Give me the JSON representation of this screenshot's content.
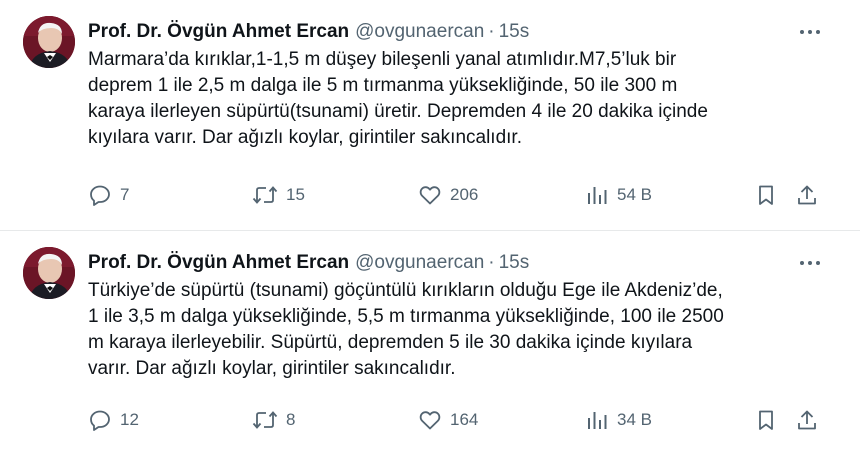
{
  "tweets": [
    {
      "author": {
        "name": "Prof. Dr. Övgün Ahmet Ercan",
        "handle": "@ovgunaercan",
        "separator": "·",
        "time": "15s"
      },
      "lines": [
        "Marmara’da kırıklar,1-1,5 m düşey bileşenli yanal atımlıdır.M7,5’luk bir",
        "deprem 1 ile 2,5 m dalga ile 5 m tırmanma yüksekliğinde, 50 ile 300 m",
        "karaya ilerleyen süpürtü(tsunami) üretir. Depremden 4 ile 20 dakika içinde",
        "kıyılara varır. Dar ağızlı koylar, girintiler sakıncalıdır."
      ],
      "stats": {
        "replies": "7",
        "reposts": "15",
        "likes": "206",
        "views": "54 B"
      }
    },
    {
      "author": {
        "name": "Prof. Dr. Övgün Ahmet Ercan",
        "handle": "@ovgunaercan",
        "separator": "·",
        "time": "15s"
      },
      "lines": [
        "Türkiye’de süpürtü (tsunami) göçüntülü kırıkların olduğu Ege ile Akdeniz’de,",
        "1 ile 3,5 m dalga yüksekliğinde, 5,5 m tırmanma yüksekliğinde, 100 ile 2500",
        "m karaya ilerleyebilir. Süpürtü, depremden 5 ile 30 dakika içinde kıyılara",
        "varır. Dar ağızlı koylar, girintiler sakıncalıdır."
      ],
      "stats": {
        "replies": "12",
        "reposts": "8",
        "likes": "164",
        "views": "34 B"
      }
    }
  ],
  "icons": {
    "more": "more-horizontal-icon",
    "reply": "reply-icon",
    "repost": "repost-icon",
    "like": "heart-icon",
    "views": "views-chart-icon",
    "bookmark": "bookmark-icon",
    "share": "share-icon"
  },
  "colors": {
    "text": "#0f1419",
    "secondary": "#536471",
    "divider": "#e7e9ea",
    "avatar_bg": "#6b1526"
  }
}
